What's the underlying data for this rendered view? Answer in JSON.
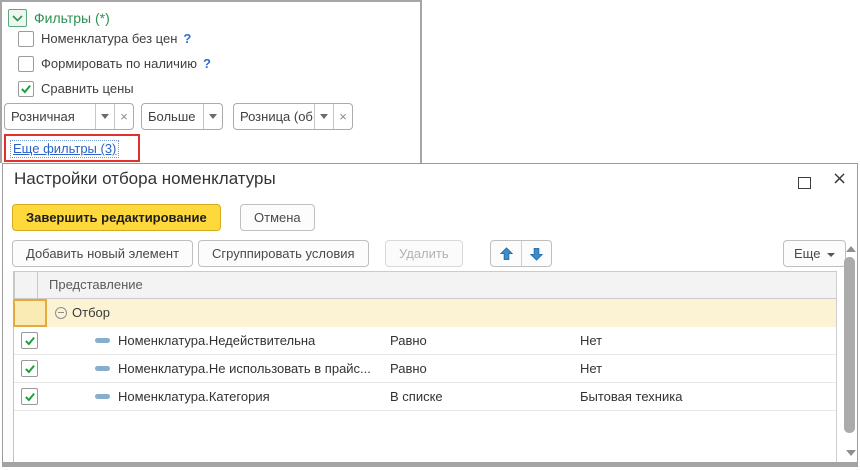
{
  "filters_panel": {
    "title": "Фильтры (*)",
    "checkboxes": [
      {
        "label": "Номенклатура без цен",
        "checked": false,
        "help": "?"
      },
      {
        "label": "Формировать по наличию",
        "checked": false,
        "help": "?"
      },
      {
        "label": "Сравнить цены",
        "checked": true,
        "help": ""
      }
    ],
    "price_filters": [
      {
        "value": "Розничная",
        "clearable": true
      },
      {
        "value": "Больше",
        "clearable": false
      },
      {
        "value": "Розница (об",
        "clearable": true
      }
    ],
    "more_filters_link": "Еще фильтры (3)"
  },
  "dialog": {
    "title": "Настройки отбора номенклатуры",
    "actions": {
      "finish": "Завершить редактирование",
      "cancel": "Отмена"
    },
    "toolbar": {
      "add": "Добавить новый элемент",
      "group": "Сгруппировать условия",
      "delete": "Удалить",
      "more": "Еще"
    },
    "table": {
      "header": "Представление",
      "group_label": "Отбор",
      "rows": [
        {
          "checked": true,
          "field": "Номенклатура.Недействительна",
          "condition": "Равно",
          "value": "Нет"
        },
        {
          "checked": true,
          "field": "Номенклатура.Не использовать в прайс...",
          "condition": "Равно",
          "value": "Нет"
        },
        {
          "checked": true,
          "field": "Номенклатура.Категория",
          "condition": "В списке",
          "value": "Бытовая техника"
        }
      ]
    }
  },
  "icons": {
    "clear": "×",
    "close": "×"
  },
  "colors": {
    "accent_green": "#2e9150",
    "primary_yellow": "#ffd93b",
    "link_blue": "#2a63c8",
    "annotation_red": "#e0312e",
    "arrow_blue": "#3c8dcc",
    "group_row_yellow": "#fbf3d3",
    "selected_cell_border": "#e5aa3c"
  }
}
